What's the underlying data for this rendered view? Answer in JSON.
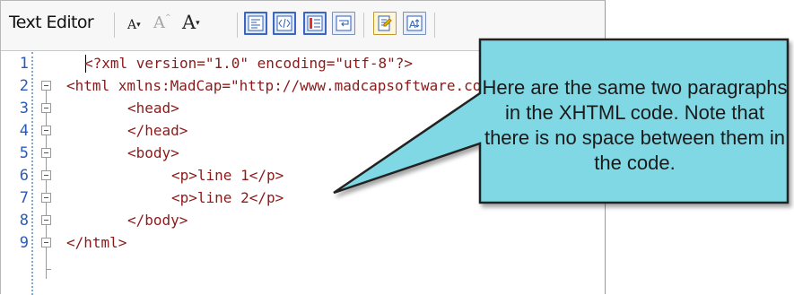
{
  "toolbar": {
    "title": "Text Editor",
    "font_buttons": [
      "A",
      "A",
      "A"
    ],
    "icons": [
      "xml-view-icon",
      "tag-view-icon",
      "structure-bar-icon",
      "word-wrap-icon",
      "insert-icon",
      "auto-format-icon"
    ]
  },
  "code_lines": [
    {
      "num": "1",
      "text": "<?xml version=\"1.0\" encoding=\"utf-8\"?>",
      "indent": 0
    },
    {
      "num": "2",
      "text": "<html xmlns:MadCap=\"http://www.madcapsoftware.com/Schemas/MadCap.xsd\">",
      "indent": 0
    },
    {
      "num": "3",
      "text": "<head>",
      "indent": 1
    },
    {
      "num": "4",
      "text": "</head>",
      "indent": 1
    },
    {
      "num": "5",
      "text": "<body>",
      "indent": 1
    },
    {
      "num": "6",
      "text": "<p>line 1</p>",
      "indent": 2
    },
    {
      "num": "7",
      "text": "<p>line 2</p>",
      "indent": 2
    },
    {
      "num": "8",
      "text": "</body>",
      "indent": 1
    },
    {
      "num": "9",
      "text": "</html>",
      "indent": 0
    }
  ],
  "callout": {
    "text": "Here are the same two paragraphs in the XHTML code. Note that there is no space between them in the code.",
    "fill_color": "#7fd8e3",
    "stroke_color": "#222222"
  },
  "colors": {
    "code_text": "#8b1a1a",
    "line_numbers": "#2a5bb8"
  }
}
